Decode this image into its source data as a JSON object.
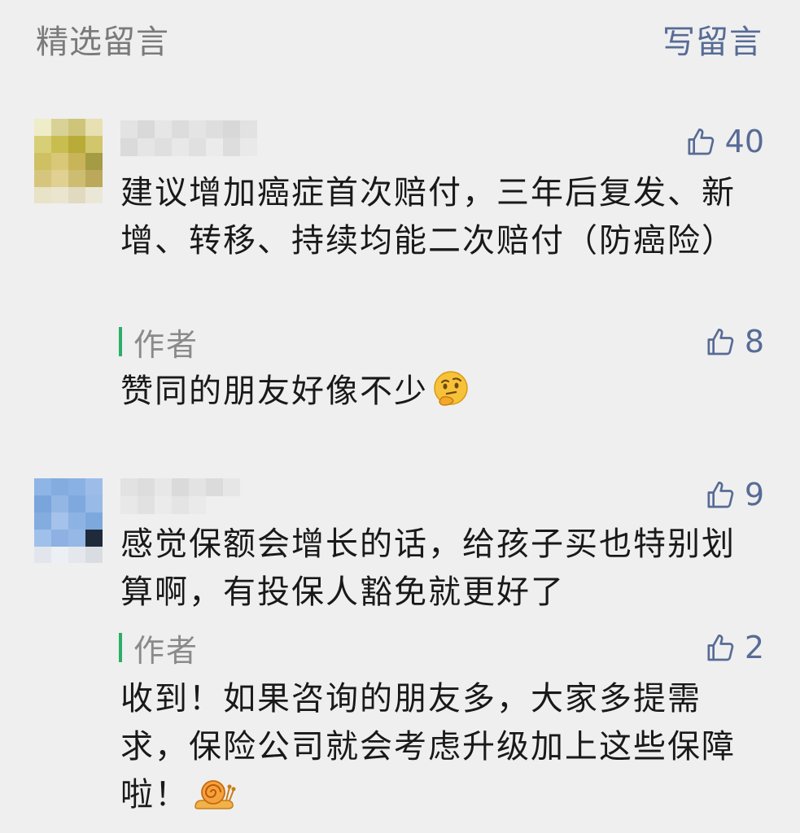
{
  "header": {
    "title": "精选留言",
    "write_label": "写留言"
  },
  "comments": [
    {
      "likes": "40",
      "text": "建议增加癌症首次赔付，三年后复发、新增、转移、持续均能二次赔付（防癌险）",
      "reply": {
        "author_label": "作者",
        "likes": "8",
        "text": "赞同的朋友好像不少",
        "emoji": "thinking-face-emoji"
      }
    },
    {
      "likes": "9",
      "text": "感觉保额会增长的话，给孩子买也特别划算啊，有投保人豁免就更好了",
      "reply": {
        "author_label": "作者",
        "likes": "2",
        "text": "收到！如果咨询的朋友多，大家多提需求，保险公司就会考虑升级加上这些保障啦！",
        "emoji": "snail-emoji"
      }
    }
  ],
  "colors": {
    "background": "#efefef",
    "link": "#576b95",
    "author_bar": "#2aae67",
    "muted": "#8a8a8a"
  }
}
